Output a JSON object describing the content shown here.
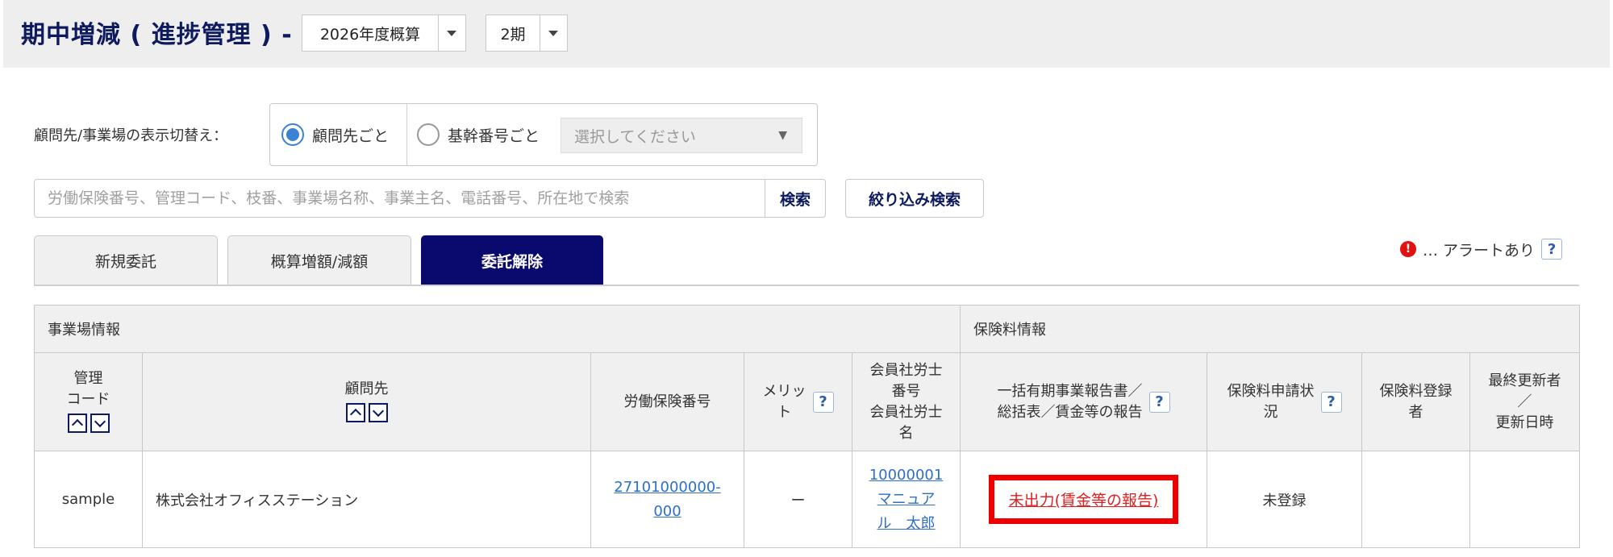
{
  "header": {
    "title": "期中増減 ( 進捗管理 ) -",
    "fiscal_year": "2026年度概算",
    "period": "2期"
  },
  "display_toggle": {
    "label": "顧問先/事業場の表示切替え：",
    "option_client": "顧問先ごと",
    "option_base_number": "基幹番号ごと",
    "select_placeholder": "選択してください",
    "selected": "顧問先ごと"
  },
  "search": {
    "placeholder": "労働保険番号、管理コード、枝番、事業場名称、事業主名、電話番号、所在地で検索",
    "value": "",
    "search_label": "検索",
    "filter_label": "絞り込み検索"
  },
  "tabs": [
    {
      "label": "新規委託",
      "active": false
    },
    {
      "label": "概算増額/減額",
      "active": false
    },
    {
      "label": "委託解除",
      "active": true
    }
  ],
  "alert_legend": {
    "icon": "!",
    "text": "… アラートあり",
    "help": "?"
  },
  "table": {
    "group_headers": [
      "事業場情報",
      "保険料情報"
    ],
    "columns": {
      "mgmt_code": "管理\nコード",
      "client": "顧問先",
      "labor_no": "労働保険番号",
      "merit": "メリッ\nト",
      "member_no": "会員社労士\n番号\n会員社労士\n名",
      "report": "一括有期事業報告書／\n総括表／賃金等の報告",
      "app_status": "保険料申請状\n況",
      "registrant": "保険料登録\n者",
      "last_updated": "最終更新者\n／\n更新日時"
    },
    "help": "?",
    "rows": [
      {
        "mgmt_code": "sample",
        "client": "株式会社オフィスステーション",
        "labor_no": "27101000000-\n000",
        "merit": "ー",
        "member_no": "10000001\nマニュア\nル　太郎",
        "report_status": "未出力(賃金等の報告)",
        "app_status": "未登録",
        "registrant": "",
        "last_updated": ""
      }
    ]
  },
  "colors": {
    "primary": "#0a0a6e",
    "alert": "#e21010",
    "link": "#2d6fc9",
    "highlight_border": "#ee0000"
  }
}
